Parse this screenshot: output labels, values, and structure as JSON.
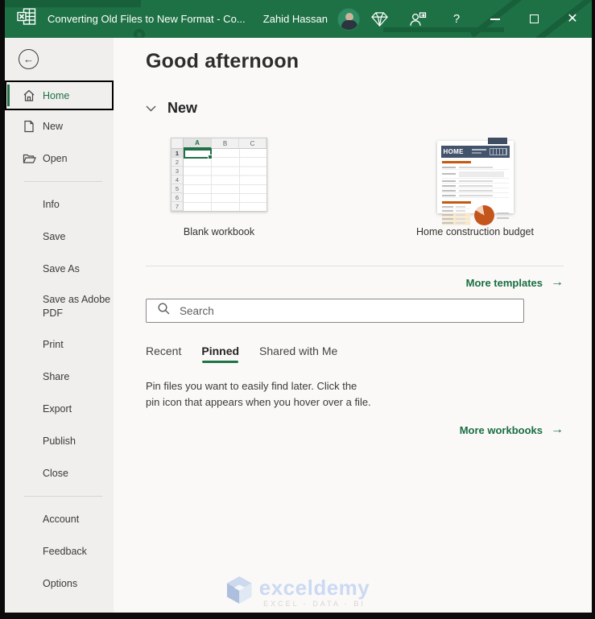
{
  "titlebar": {
    "title": "Converting Old Files to New Format  -  Co...",
    "user_name": "Zahid Hassan",
    "help_label": "?"
  },
  "icons": {
    "back_arrow": "←",
    "arrow_right": "→"
  },
  "sidebar": {
    "items_top": [
      {
        "label": "Home",
        "selected": true
      },
      {
        "label": "New"
      },
      {
        "label": "Open"
      }
    ],
    "items_middle": [
      {
        "label": "Info"
      },
      {
        "label": "Save"
      },
      {
        "label": "Save As"
      },
      {
        "label": "Save as Adobe PDF"
      },
      {
        "label": "Print"
      },
      {
        "label": "Share"
      },
      {
        "label": "Export"
      },
      {
        "label": "Publish"
      },
      {
        "label": "Close"
      }
    ],
    "items_bottom": [
      {
        "label": "Account"
      },
      {
        "label": "Feedback"
      },
      {
        "label": "Options"
      }
    ]
  },
  "main": {
    "greeting": "Good afternoon",
    "new_section": {
      "title": "New",
      "more_link": "More templates",
      "templates": [
        {
          "label": "Blank workbook",
          "grid_cols": [
            "A",
            "B",
            "C"
          ],
          "grid_rows": [
            "1",
            "2",
            "3",
            "4",
            "5",
            "6",
            "7"
          ]
        },
        {
          "label": "Home construction budget",
          "header_text": "HOME"
        }
      ]
    },
    "search": {
      "placeholder": "Search"
    },
    "tabs": [
      {
        "label": "Recent",
        "active": false
      },
      {
        "label": "Pinned",
        "active": true
      },
      {
        "label": "Shared with Me",
        "active": false
      }
    ],
    "pinned_empty_message": "Pin files you want to easily find later. Click the pin icon that appears when you hover over a file.",
    "more_workbooks_link": "More workbooks"
  },
  "watermark": {
    "brand": "exceldemy",
    "tagline": "EXCEL - DATA - BI"
  },
  "colors": {
    "titlebar_green": "#1e7145",
    "accent_green": "#217346",
    "link_green": "#1a6e41",
    "selection_green": "#1e7144"
  }
}
